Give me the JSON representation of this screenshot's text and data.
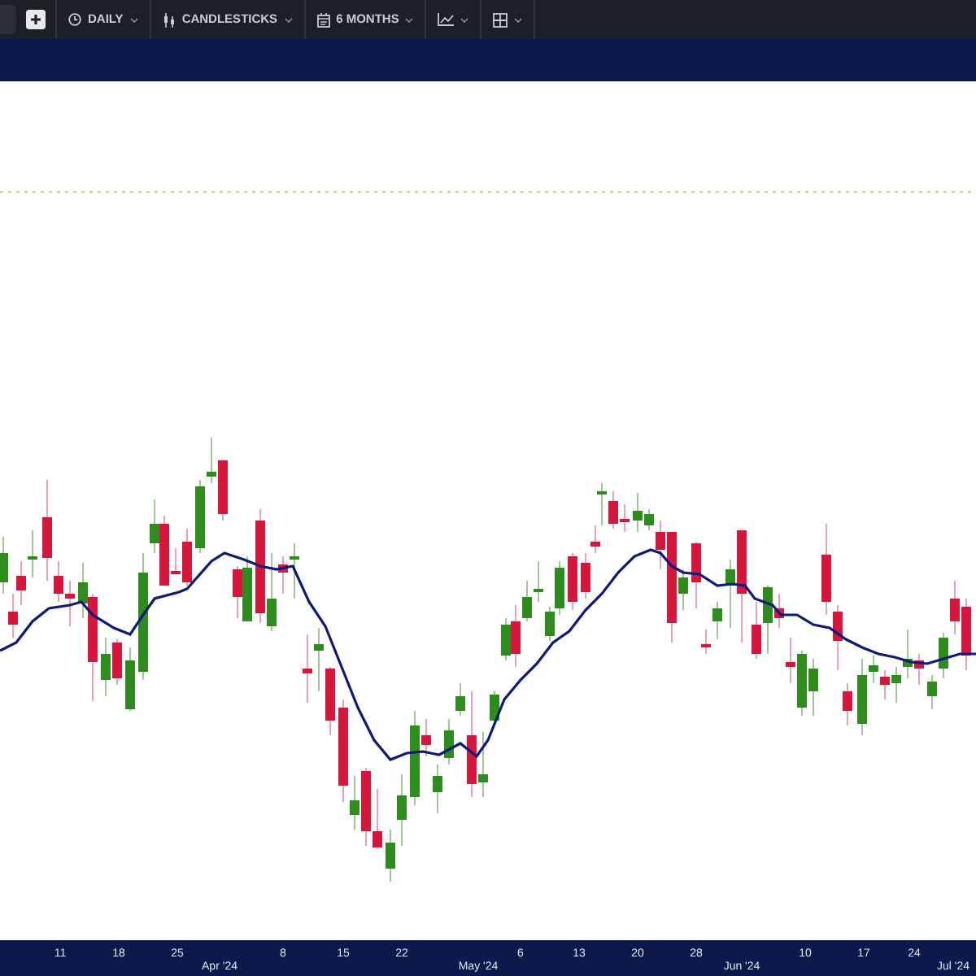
{
  "toolbar": {
    "items": [
      {
        "kind": "add"
      },
      {
        "kind": "interval",
        "label": "DAILY"
      },
      {
        "kind": "chart_type",
        "label": "CANDLESTICKS"
      },
      {
        "kind": "range",
        "label": "6 MONTHS"
      },
      {
        "kind": "indicators"
      },
      {
        "kind": "layout"
      }
    ]
  },
  "chart": {
    "x_axis": {
      "day_labels": [
        "11",
        "18",
        "25",
        "8",
        "15",
        "22",
        "6",
        "13",
        "20",
        "28",
        "10",
        "17",
        "24"
      ],
      "month_labels": [
        "Apr '24",
        "May '24",
        "Jun '24",
        "Jul '24"
      ]
    }
  }
}
